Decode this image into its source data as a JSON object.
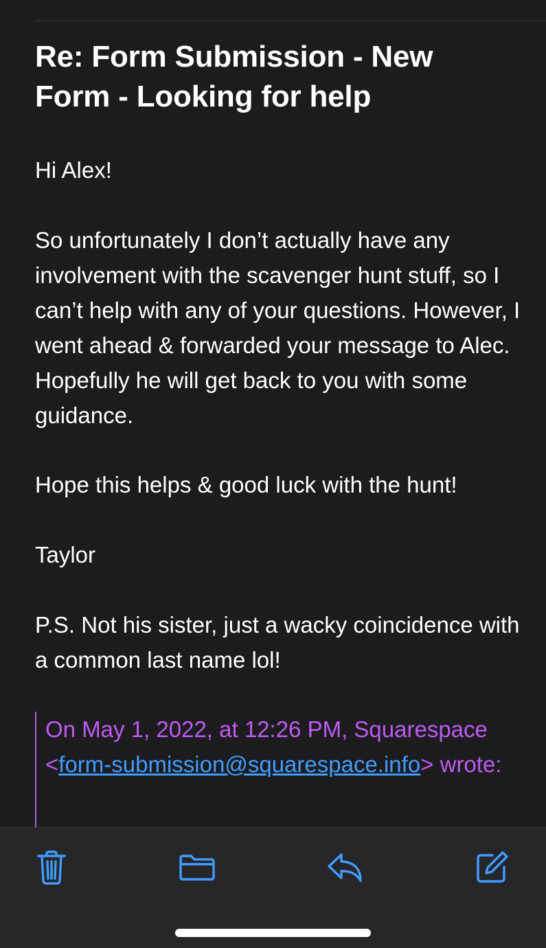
{
  "email": {
    "subject": "Re: Form Submission - New Form - Looking for help",
    "body": [
      "Hi Alex!",
      "So unfortunately I don’t actually have any involvement with the scavenger hunt stuff, so I can’t help with any of your questions. However, I went ahead & forwarded your message to Alec. Hopefully he will get back to you with some guidance.",
      "Hope this helps & good luck with the hunt!",
      "Taylor",
      "P.S. Not his sister, just a wacky coincidence with a common last name lol!"
    ],
    "quote": {
      "prefix": "On May 1, 2022, at 12:26 PM, Squarespace <",
      "link": "form-submission@squarespace.info",
      "suffix": "> wrote:"
    }
  },
  "toolbar": {
    "icons": [
      "trash-icon",
      "folder-icon",
      "reply-icon",
      "compose-icon"
    ],
    "icon_color": "#409cff"
  },
  "colors": {
    "background": "#1c1c1e",
    "quote_text": "#bf5af2",
    "quote_bar": "#b05cd8",
    "link": "#409cff",
    "toolbar_bg": "#262629"
  }
}
